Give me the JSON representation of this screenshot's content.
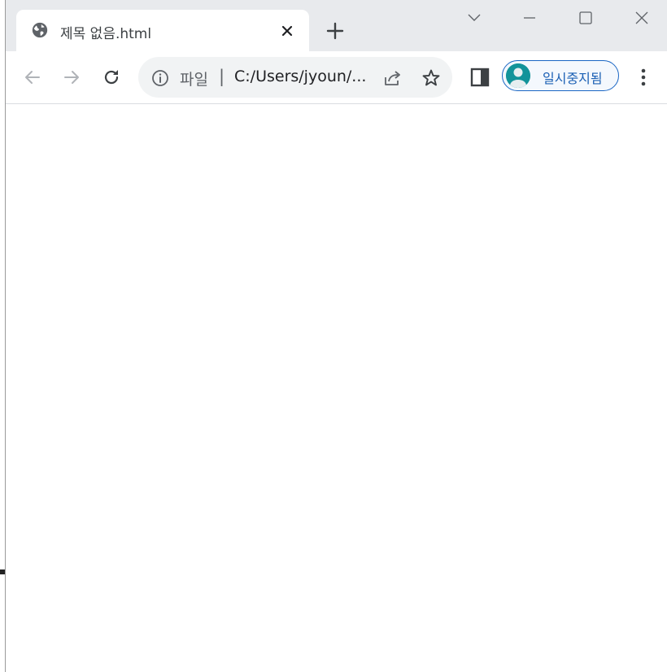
{
  "window": {
    "tab": {
      "title": "제목 없음.html",
      "favicon": "globe-icon"
    },
    "controls": [
      "tab-search-icon",
      "minimize-icon",
      "maximize-icon",
      "close-icon"
    ]
  },
  "toolbar": {
    "omnibox": {
      "scheme_label": "파일",
      "separator": "|",
      "url": "C:/Users/jyoun/..."
    },
    "profile": {
      "label": "일시중지됨",
      "accent": "#1a66c4",
      "avatar_color": "#12939a"
    }
  },
  "colors": {
    "tab_strip": "#e8eaed",
    "omnibox_bg": "#f1f3f4",
    "icon": "#5f6368"
  }
}
